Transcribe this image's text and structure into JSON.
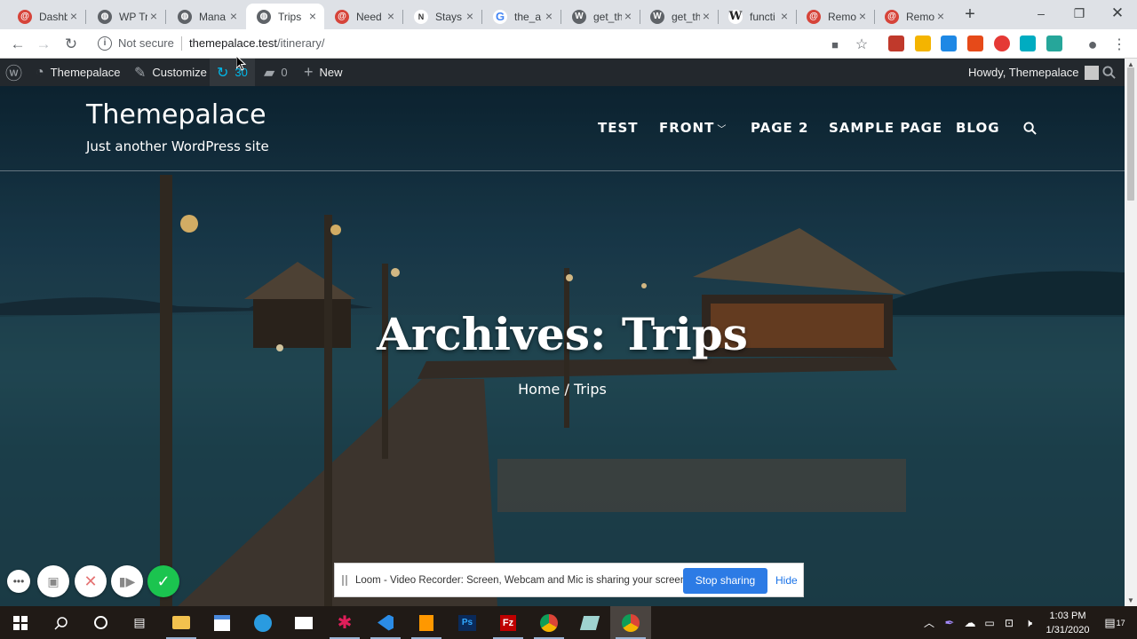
{
  "browser": {
    "tabs": [
      {
        "label": "Dashb",
        "icon": "wp-favicon-red",
        "color": "#d6443a"
      },
      {
        "label": "WP Tr",
        "icon": "globe-icon",
        "color": "#5f6368"
      },
      {
        "label": "Mana",
        "icon": "globe-icon",
        "color": "#5f6368"
      },
      {
        "label": "Trips",
        "icon": "globe-icon",
        "color": "#5f6368",
        "active": true
      },
      {
        "label": "Need",
        "icon": "wp-favicon-red",
        "color": "#d6443a"
      },
      {
        "label": "Stays",
        "icon": "nyt-icon",
        "color": "#333333"
      },
      {
        "label": "the_a",
        "icon": "google-icon",
        "color": "#4285f4"
      },
      {
        "label": "get_th",
        "icon": "wordpress-icon",
        "color": "#5f6368"
      },
      {
        "label": "get_th",
        "icon": "wordpress-icon",
        "color": "#5f6368"
      },
      {
        "label": "functi",
        "icon": "wikipedia-icon",
        "color": "#333333"
      },
      {
        "label": "Remo",
        "icon": "wp-favicon-red",
        "color": "#d6443a"
      },
      {
        "label": "Remo",
        "icon": "wp-favicon-red",
        "color": "#d6443a"
      }
    ],
    "not_secure": "Not secure",
    "url_host": "themepalace.test",
    "url_path": "/itinerary/"
  },
  "admin_bar": {
    "site_name": "Themepalace",
    "customize": "Customize",
    "updates": "30",
    "comments": "0",
    "new": "New",
    "howdy": "Howdy, Themepalace"
  },
  "site": {
    "title": "Themepalace",
    "tagline": "Just another WordPress site",
    "menu": [
      "TEST",
      "FRONT",
      "PAGE 2",
      "SAMPLE PAGE",
      "BLOG"
    ],
    "archive_title": "Archives: Trips",
    "breadcrumb": "Home / Trips"
  },
  "loom": {
    "message": "Loom - Video Recorder: Screen, Webcam and Mic is sharing your screen.",
    "stop": "Stop sharing",
    "hide": "Hide"
  },
  "taskbar": {
    "time": "1:03 PM",
    "date": "1/31/2020",
    "notifications": "17"
  },
  "colors": {
    "accent": "#2c7be5",
    "adminbar": "#23282d",
    "loom_green": "#1bc44f"
  }
}
